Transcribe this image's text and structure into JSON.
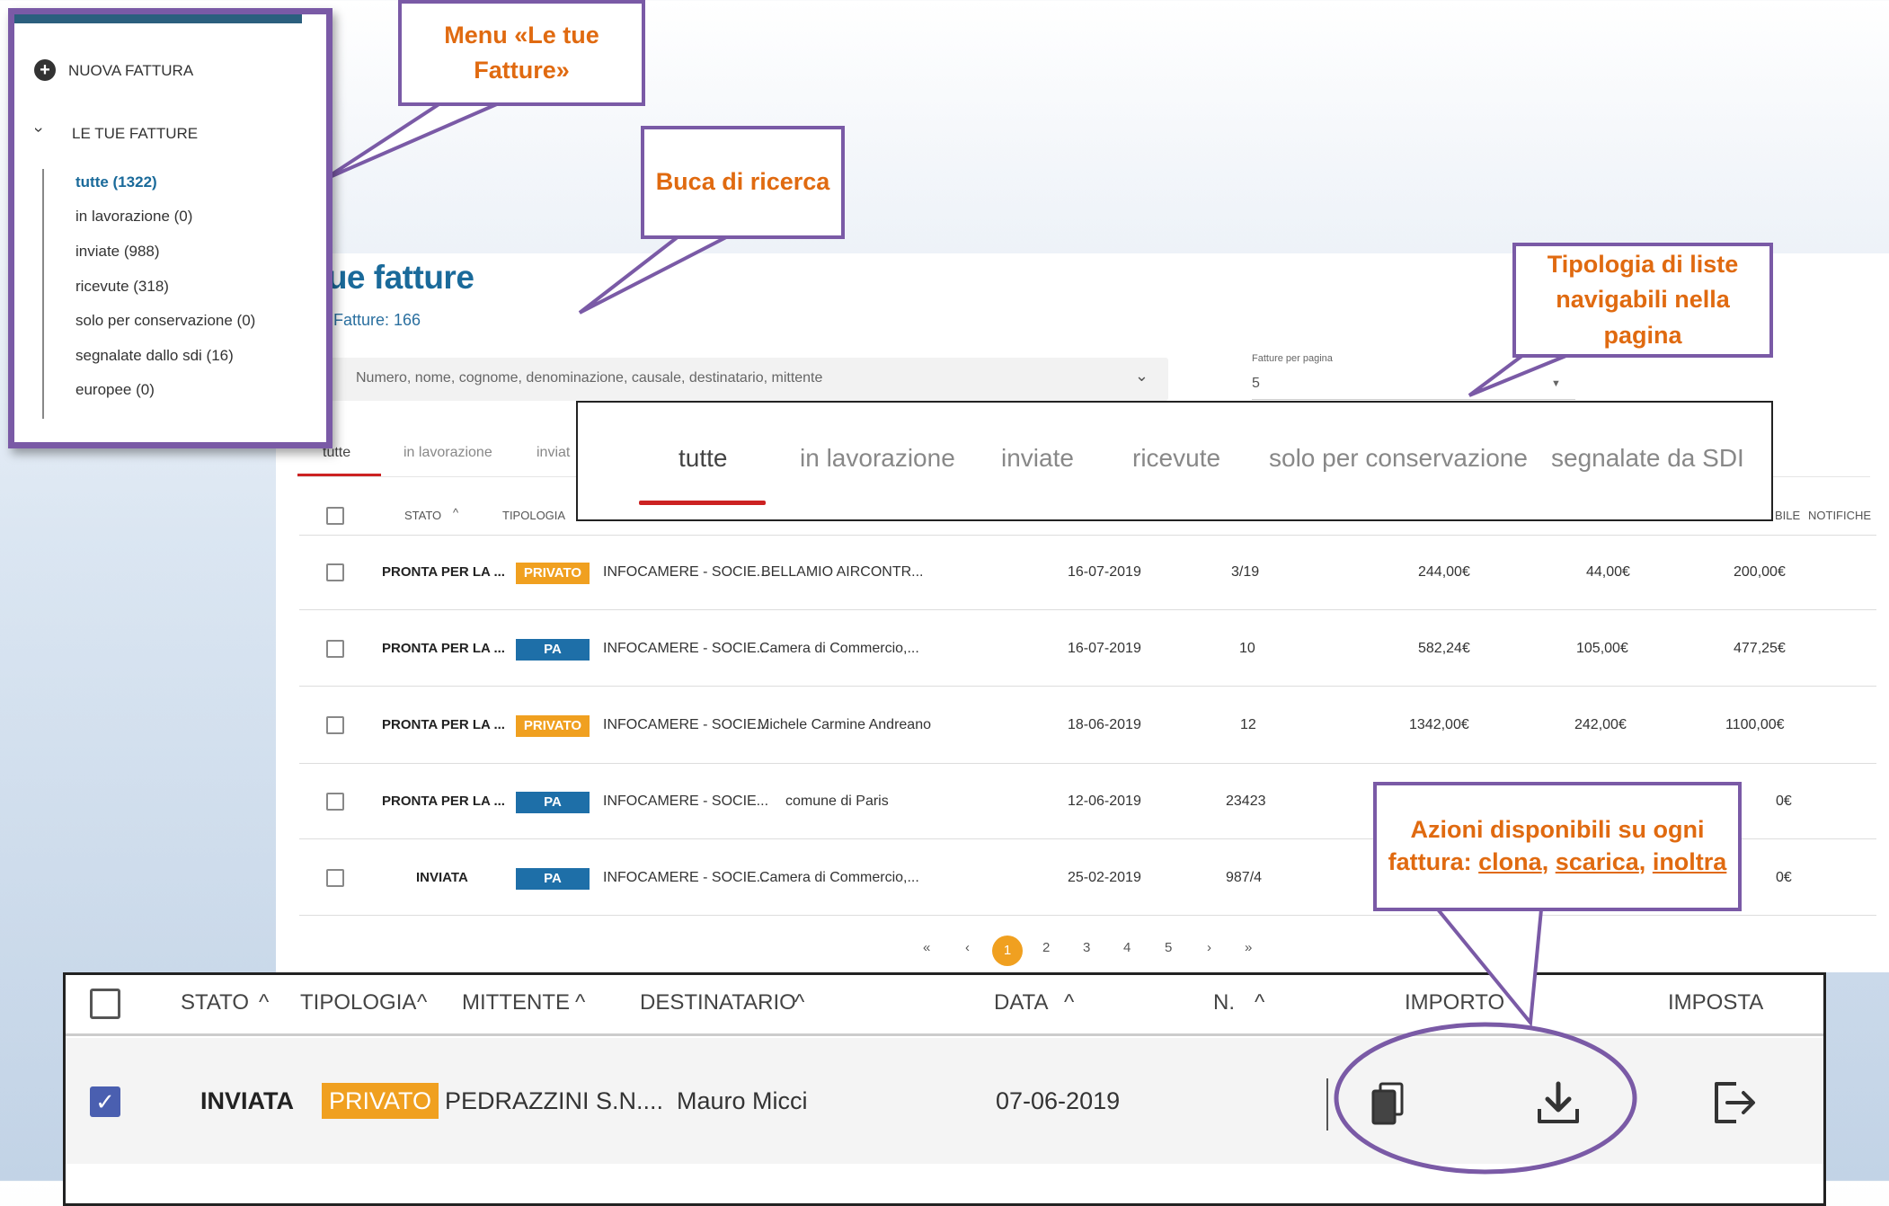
{
  "page": {
    "title": "tue fatture",
    "subtitle": "le Fatture: 166"
  },
  "search": {
    "placeholder": "Numero, nome, cognome, denominazione, causale, destinatario, mittente"
  },
  "per_page": {
    "label": "Fatture per pagina",
    "value": "5"
  },
  "tabs_small": [
    "tutte",
    "in lavorazione",
    "inviat"
  ],
  "table_header_small": {
    "stato": "STATO",
    "tipologia": "TIPOLOGIA",
    "right_partial": "BILE",
    "notifiche": "NOTIFICHE"
  },
  "rows": [
    {
      "stato": "PRONTA PER LA ...",
      "tipologia": "PRIVATO",
      "mittente": "INFOCAMERE - SOCIE...",
      "destinatario": "BELLAMIO AIRCONTR...",
      "data": "16-07-2019",
      "numero": "3/19",
      "importo": "244,00€",
      "imposta": "44,00€",
      "imponibile": "200,00€"
    },
    {
      "stato": "PRONTA PER LA ...",
      "tipologia": "PA",
      "mittente": "INFOCAMERE - SOCIE...",
      "destinatario": "Camera di Commercio,...",
      "data": "16-07-2019",
      "numero": "10",
      "importo": "582,24€",
      "imposta": "105,00€",
      "imponibile": "477,25€"
    },
    {
      "stato": "PRONTA PER LA ...",
      "tipologia": "PRIVATO",
      "mittente": "INFOCAMERE - SOCIE...",
      "destinatario": "Michele Carmine Andreano",
      "data": "18-06-2019",
      "numero": "12",
      "importo": "1342,00€",
      "imposta": "242,00€",
      "imponibile": "1100,00€"
    },
    {
      "stato": "PRONTA PER LA ...",
      "tipologia": "PA",
      "mittente": "INFOCAMERE - SOCIE...",
      "destinatario": "comune di Paris",
      "data": "12-06-2019",
      "numero": "23423",
      "importo": "",
      "imposta": "",
      "imponibile": "0€"
    },
    {
      "stato": "INVIATA",
      "tipologia": "PA",
      "mittente": "INFOCAMERE - SOCIE...",
      "destinatario": "Camera di Commercio,...",
      "data": "25-02-2019",
      "numero": "987/4",
      "importo": "",
      "imposta": "",
      "imponibile": "0€"
    }
  ],
  "pagination": {
    "first": "«",
    "prev": "‹",
    "pages": [
      "1",
      "2",
      "3",
      "4",
      "5"
    ],
    "next": "›",
    "last": "»",
    "current": "1"
  },
  "sidebar": {
    "new_invoice": "NUOVA FATTURA",
    "section": "LE TUE FATTURE",
    "items": [
      "tutte (1322)",
      "in lavorazione (0)",
      "inviate (988)",
      "ricevute (318)",
      "solo per conservazione (0)",
      "segnalate dallo sdi (16)",
      "europee (0)"
    ]
  },
  "callouts": {
    "menu": "Menu «Le tue Fatture»",
    "search": "Buca di ricerca",
    "lists": "Tipologia di liste navigabili nella pagina",
    "actions_prefix": "Azioni disponibili su ogni fattura:",
    "clona": "clona",
    "scarica": "scarica",
    "inoltra": "inoltra"
  },
  "tabs_zoom": [
    "tutte",
    "in lavorazione",
    "inviate",
    "ricevute",
    "solo per conservazione",
    "segnalate da SDI"
  ],
  "table_zoom": {
    "headers": {
      "stato": "STATO",
      "tipologia": "TIPOLOGIA",
      "mittente": "MITTENTE",
      "destinatario": "DESTINATARIO",
      "data": "DATA",
      "numero": "N.",
      "importo": "IMPORTO",
      "imposta": "IMPOSTA"
    },
    "row": {
      "stato": "INVIATA",
      "tipologia": "PRIVATO",
      "mittente": "PEDRAZZINI S.N....",
      "destinatario": "Mauro Micci",
      "data": "07-06-2019"
    }
  },
  "colors": {
    "accent_blue": "#1a6a9a",
    "privato": "#f0a020",
    "pa": "#1e6fa8",
    "callout_border": "#7a5aa6",
    "callout_text": "#e06a10",
    "tab_active": "#cc2222"
  },
  "icons": [
    "plus-circle-icon",
    "chevron-down-icon",
    "sort-up-icon",
    "copy-icon",
    "download-icon",
    "share-exit-icon",
    "checkbox-checked-icon"
  ]
}
